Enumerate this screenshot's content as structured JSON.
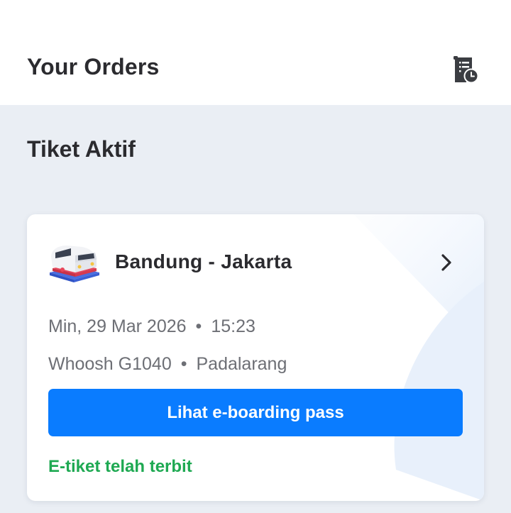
{
  "header": {
    "title": "Your Orders",
    "history_icon": "order-history-icon"
  },
  "section": {
    "title": "Tiket Aktif"
  },
  "ticket": {
    "route": "Bandung - Jakarta",
    "date": "Min, 29 Mar 2026",
    "time": "15:23",
    "train": "Whoosh G1040",
    "station": "Padalarang",
    "button_label": "Lihat e-boarding pass",
    "status": "E-tiket telah terbit",
    "separator": "•",
    "icon": "train-icon"
  },
  "colors": {
    "accent": "#0a7cff",
    "status_green": "#1ea952",
    "background": "#eaeef4"
  }
}
